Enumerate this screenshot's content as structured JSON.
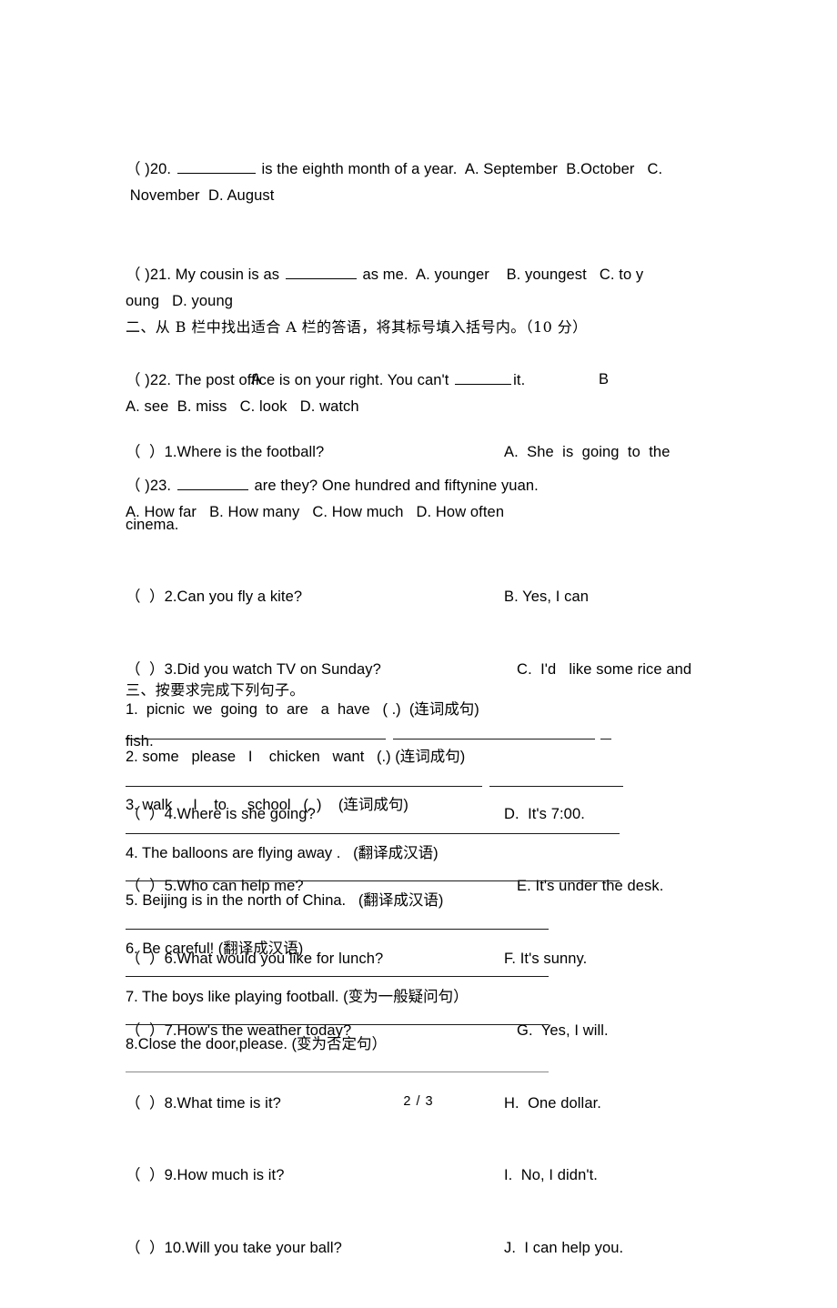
{
  "document": {
    "footer_page": "2 / 3"
  },
  "multiple_choice": {
    "items": [
      {
        "id": "q20",
        "pre": "（ )20. ",
        "blank": "w-long",
        "post": " is the eighth month of a year.  A. September  B.October   C.\n November  D. August"
      },
      {
        "id": "q21",
        "pre": "（ )21. My cousin is as ",
        "blank": "w-mid",
        "post": " as me.  A. younger    B. youngest   C. to y\noung   D. young"
      },
      {
        "id": "q22",
        "pre": "（ )22. The post office is on your right. You can't ",
        "blank": "w-short",
        "post": "it.\nA. see  B. miss   C. look   D. watch"
      },
      {
        "id": "q23",
        "pre": "（ )23. ",
        "blank": "w-mid",
        "post": " are they? One hundred and fiftynine yuan.\nA. How far   B. How many   C. How much   D. How often"
      }
    ]
  },
  "section2": {
    "heading": "二、从 B 栏中找出适合 A 栏的答语，将其标号填入括号内。（10 分）",
    "column_a_header": "A",
    "column_b_header": "B",
    "column_a": [
      "（  ）1.Where is the football?",
      "（  ）2.Can you fly a kite?",
      "（  ）3.Did you watch TV on Sunday?",
      "（  ）4.Where is she going?",
      "（  ）5.Who can help me?",
      "（  ）6.What would you like for lunch?",
      "（  ）7.How's the weather today?",
      "（  ）8.What time is it?",
      "（  ）9.How much is it?",
      "（  ）10.Will you take your ball?"
    ],
    "column_a_wraps": {
      "after_item_1": "cinema.",
      "after_item_3": "fish."
    },
    "column_b": [
      "A.  She  is  going  to  the",
      "B. Yes, I can",
      "   C.  I'd   like some rice and",
      "D.  It's 7:00.",
      "   E. It's under the desk.",
      "F. It's sunny.",
      "   G.  Yes, I will.",
      "H.  One dollar.",
      "I.  No, I didn't.",
      "J.  I can help you."
    ]
  },
  "section3": {
    "heading": "三、按要求完成下列句子。",
    "items": [
      {
        "id": "s3q1",
        "text": "1.  picnic  we  going  to  are   a  have   ( .)  (连词成句)"
      },
      {
        "id": "s3q2",
        "text": "2. some   please   I    chicken   want   (.) (连词成句)"
      },
      {
        "id": "s3q3",
        "text": "3. walk     I    to     school   (. )    (连词成句)"
      },
      {
        "id": "s3q4",
        "text": "4. The balloons are flying away .   (翻译成汉语)"
      },
      {
        "id": "s3q5",
        "text": "5. Beijing is in the north of China.   (翻译成汉语)"
      },
      {
        "id": "s3q6",
        "text": "6. Be careful! (翻译成汉语)"
      },
      {
        "id": "s3q7",
        "text": "7. The boys like playing football. (变为一般疑问句）"
      },
      {
        "id": "s3q8",
        "text": "8.Close the door,please. (变为否定句）"
      }
    ]
  }
}
